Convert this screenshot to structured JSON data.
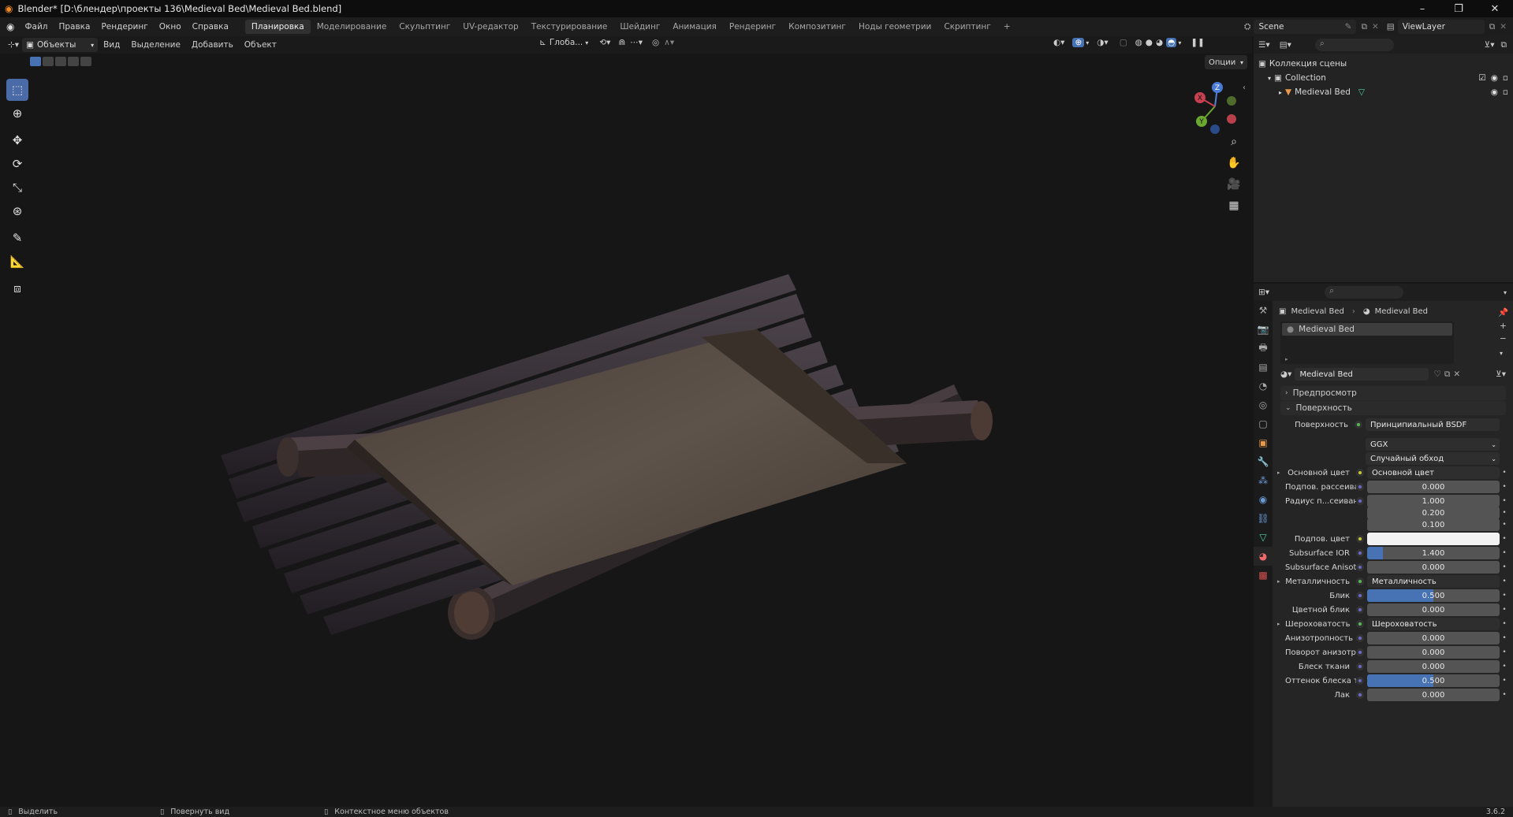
{
  "window": {
    "title": "Blender* [D:\\блендер\\проекты 136\\Medieval Bed\\Medieval Bed.blend]",
    "controls": [
      "–",
      "❐",
      "✕"
    ]
  },
  "menu": {
    "items": [
      "Файл",
      "Правка",
      "Рендеринг",
      "Окно",
      "Справка"
    ],
    "workspaces": [
      "Планировка",
      "Моделирование",
      "Скульптинг",
      "UV-редактор",
      "Текстурирование",
      "Шейдинг",
      "Анимация",
      "Рендеринг",
      "Композитинг",
      "Ноды геометрии",
      "Скриптинг"
    ],
    "active_workspace": "Планировка",
    "add_tab": "+",
    "scene": "Scene",
    "view_layer": "ViewLayer"
  },
  "viewport_header": {
    "mode": "Объекты",
    "menus": [
      "Вид",
      "Выделение",
      "Добавить",
      "Объект"
    ],
    "transform_orientation": "Глоба...",
    "options": "Опции"
  },
  "gizmo": {
    "z": "Z",
    "y": "Y",
    "x": "X"
  },
  "outliner": {
    "root": "Коллекция сцены",
    "collection": "Collection",
    "object": "Medieval Bed"
  },
  "properties": {
    "breadcrumb_object": "Medieval Bed",
    "breadcrumb_material": "Medieval Bed",
    "material_slot": "Medieval Bed",
    "material_name": "Medieval Bed",
    "panels": {
      "preview": "Предпросмотр",
      "surface": "Поверхность"
    },
    "surface_label": "Поверхность",
    "surface_value": "Принципиальный BSDF",
    "distribution": "GGX",
    "subsurface_method": "Случайный обход",
    "rows": [
      {
        "label": "Основной цвет",
        "value": "Основной цвет",
        "kind": "link",
        "dot": "yel",
        "expand": true
      },
      {
        "label": "Подпов. рассеива...",
        "value": "0.000",
        "kind": "num",
        "fill": 0
      },
      {
        "label": "Радиус п...сеивания",
        "value": "1.000",
        "kind": "num",
        "fill": 0
      },
      {
        "label": "",
        "value": "0.200",
        "kind": "num",
        "fill": 0
      },
      {
        "label": "",
        "value": "0.100",
        "kind": "num",
        "fill": 0
      },
      {
        "label": "Подпов. цвет",
        "value": "",
        "kind": "color",
        "dot": "yel"
      },
      {
        "label": "Subsurface IOR",
        "value": "1.400",
        "kind": "num",
        "fill": 0.12
      },
      {
        "label": "Subsurface Anisotr...",
        "value": "0.000",
        "kind": "num",
        "fill": 0
      },
      {
        "label": "Металличность",
        "value": "Металличность",
        "kind": "link",
        "dot": "grn",
        "expand": true
      },
      {
        "label": "Блик",
        "value": "0.500",
        "kind": "num",
        "fill": 0.5
      },
      {
        "label": "Цветной блик",
        "value": "0.000",
        "kind": "num",
        "fill": 0
      },
      {
        "label": "Шероховатость",
        "value": "Шероховатость",
        "kind": "link",
        "dot": "grn",
        "expand": true
      },
      {
        "label": "Анизотропность",
        "value": "0.000",
        "kind": "num",
        "fill": 0
      },
      {
        "label": "Поворот анизотро...",
        "value": "0.000",
        "kind": "num",
        "fill": 0
      },
      {
        "label": "Блеск ткани",
        "value": "0.000",
        "kind": "num",
        "fill": 0
      },
      {
        "label": "Оттенок блеска тк...",
        "value": "0.500",
        "kind": "num",
        "fill": 0.5
      },
      {
        "label": "Лак",
        "value": "0.000",
        "kind": "num",
        "fill": 0
      }
    ]
  },
  "statusbar": {
    "select": "Выделить",
    "rotate": "Повернуть вид",
    "context": "Контекстное меню объектов",
    "version": "3.6.2"
  }
}
